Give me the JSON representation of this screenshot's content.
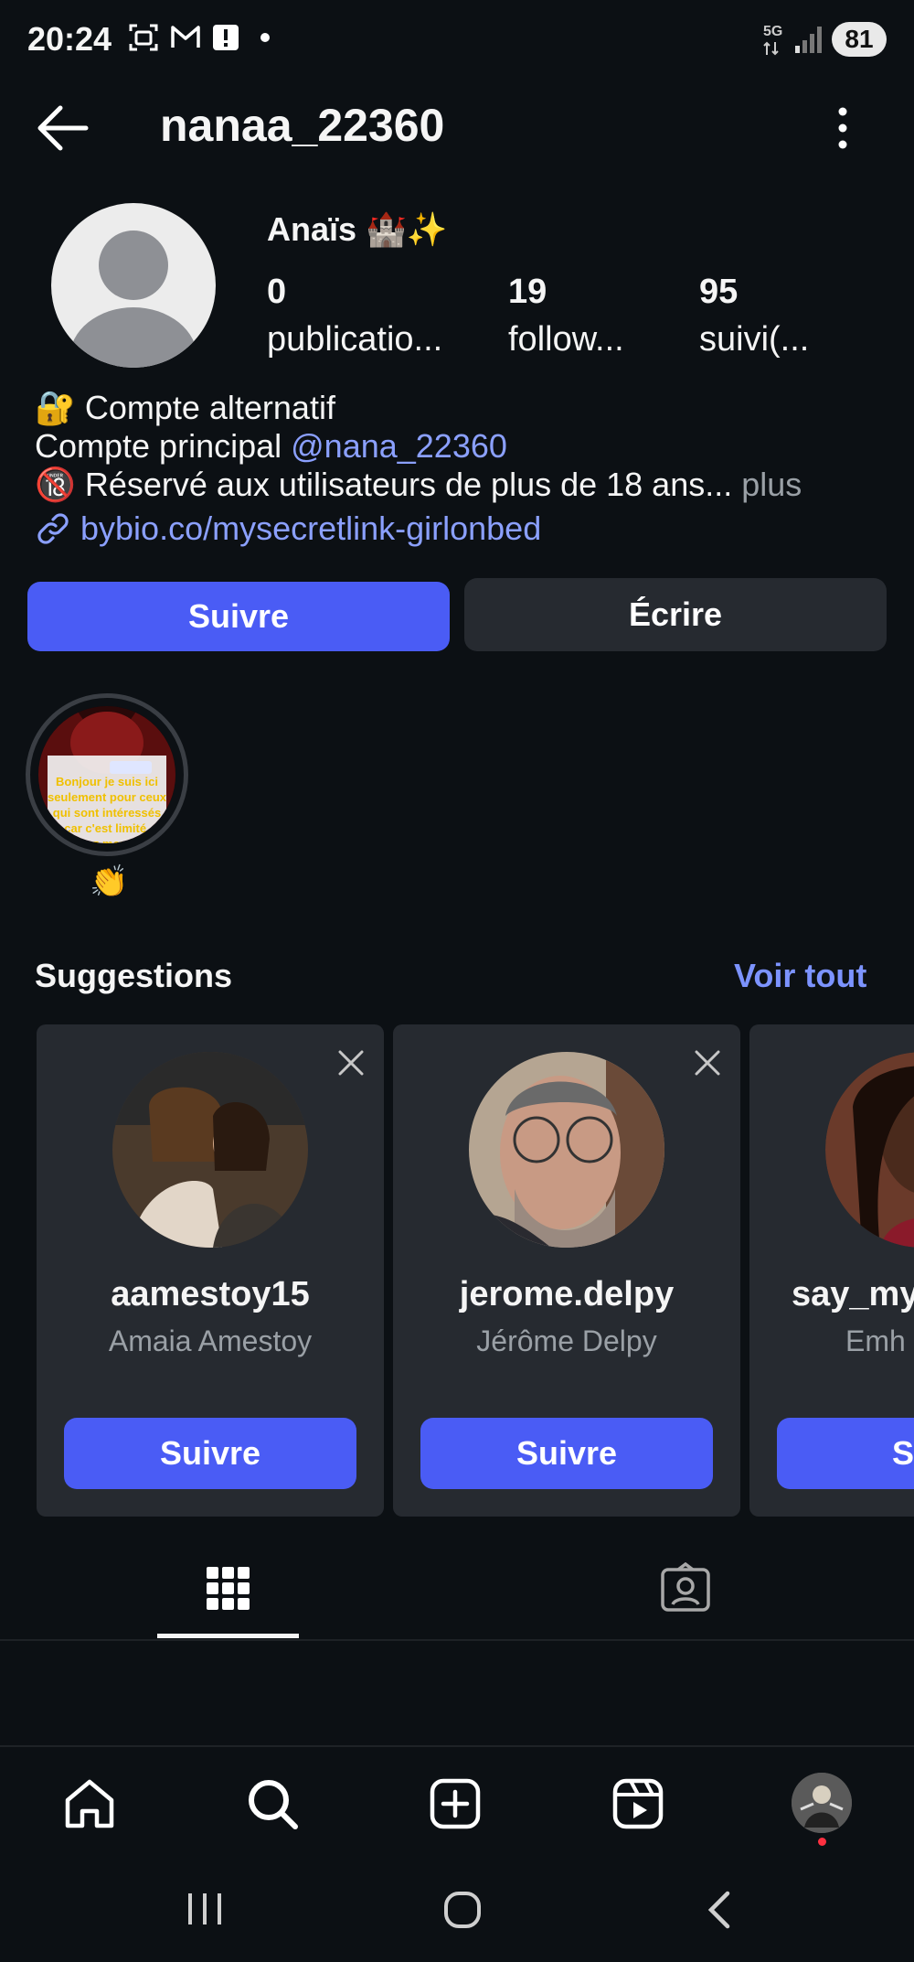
{
  "status_bar": {
    "time": "20:24",
    "network": "5G",
    "battery": "81",
    "icons": [
      "screenshot-icon",
      "gmail-icon",
      "alert-icon",
      "dot-icon",
      "signal-icon"
    ]
  },
  "header": {
    "username": "nanaa_22360",
    "icons": [
      "back-arrow-icon",
      "more-vertical-icon"
    ]
  },
  "profile": {
    "display_name": "Anaïs 🏰✨",
    "stats": [
      {
        "value": "0",
        "label": "publicatio..."
      },
      {
        "value": "19",
        "label": "follow..."
      },
      {
        "value": "95",
        "label": "suivi(..."
      }
    ],
    "bio": {
      "line1": "🔐 Compte alternatif",
      "line2_prefix": "Compte principal ",
      "line2_mention": "@nana_22360",
      "line3": "🔞 Réservé aux utilisateurs de plus de 18 ans...",
      "line3_more": " plus",
      "link": "bybio.co/mysecretlink-girlonbed"
    }
  },
  "actions": {
    "follow": "Suivre",
    "message": "Écrire"
  },
  "highlights": [
    {
      "label": "👏",
      "text": "Bonjour je suis ici seulement pour ceux qui sont intéressés car c'est limité, visitez mon lien"
    }
  ],
  "suggestions": {
    "title": "Suggestions",
    "see_all": "Voir tout",
    "cards": [
      {
        "username": "aamestoy15",
        "name": "Amaia Amestoy",
        "button": "Suivre"
      },
      {
        "username": "jerome.delpy",
        "name": "Jérôme Delpy",
        "button": "Suivre"
      },
      {
        "username": "say_my",
        "name": "Emh",
        "button": "Su"
      }
    ]
  },
  "tabs": [
    "grid-icon",
    "tagged-icon"
  ],
  "bottom_nav": [
    "home-icon",
    "search-icon",
    "create-icon",
    "reels-icon",
    "profile-avatar"
  ],
  "colors": {
    "background": "#0c1014",
    "accent": "#4a5cf5",
    "link": "#8ba0ff",
    "card": "#262a30"
  }
}
